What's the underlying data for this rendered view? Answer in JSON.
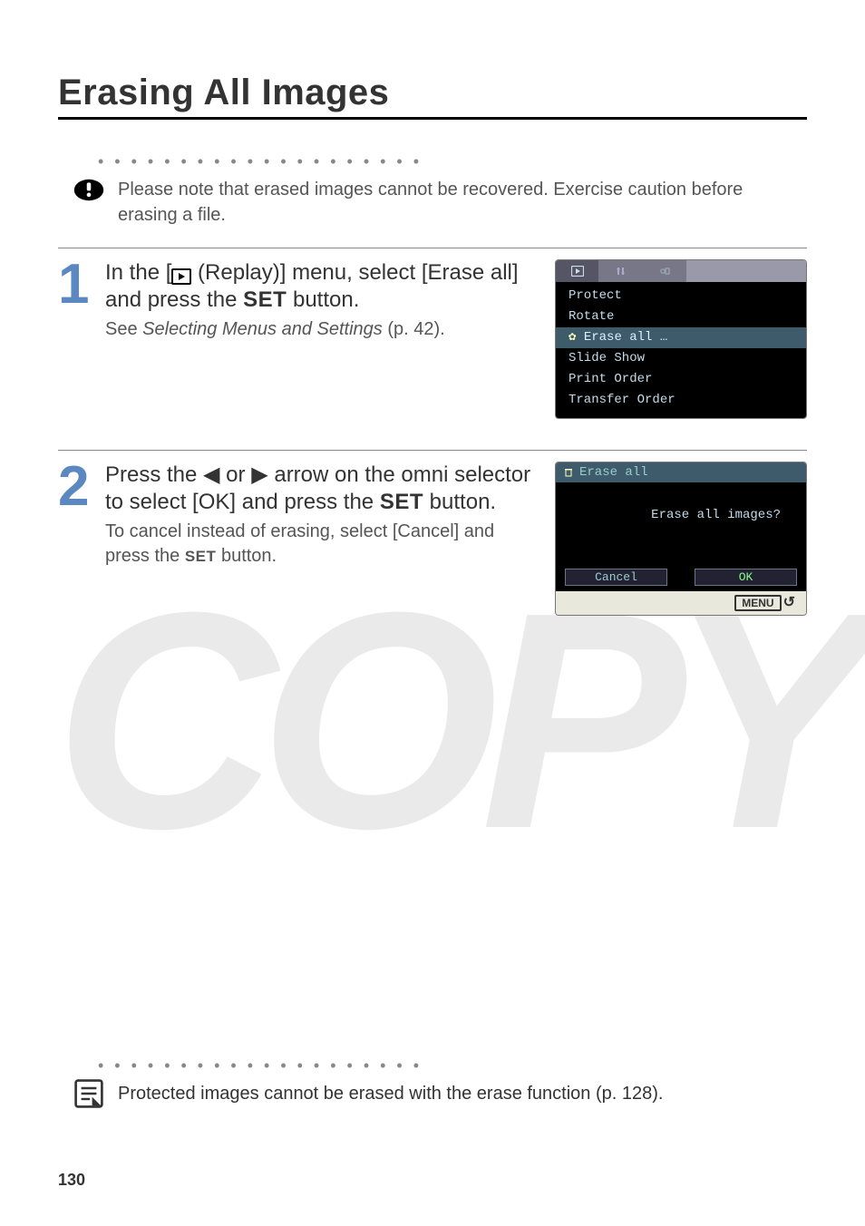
{
  "title": "Erasing All Images",
  "warning_text": "Please note that erased images cannot be recovered. Exercise caution before erasing a file.",
  "step1": {
    "head_pre": "In the [",
    "head_post": " (Replay)] menu, select [Erase all] and press the ",
    "head_end": " button.",
    "set_label": "SET",
    "sub_pre": "See ",
    "sub_italic": "Selecting Menus and Settings",
    "sub_post": " (p. 42)."
  },
  "lcd1_items": [
    "Protect",
    "Rotate",
    "Erase all …",
    "Slide Show",
    "Print Order",
    "Transfer Order"
  ],
  "step2": {
    "head_pre": "Press the ",
    "head_mid": " arrow on the omni selector to select [OK] and press the ",
    "head_end": " button.",
    "or_word": " or ",
    "set_label": "SET",
    "sub": "To cancel instead of erasing, select [Cancel] and press the ",
    "sub_end": " button."
  },
  "lcd2": {
    "title": "Erase all",
    "question": "Erase all images?",
    "cancel": "Cancel",
    "ok": "OK",
    "menu": "MENU"
  },
  "footer_text": "Protected images cannot be erased with the erase function (p. 128).",
  "page_number": "130",
  "watermark": "COPY"
}
